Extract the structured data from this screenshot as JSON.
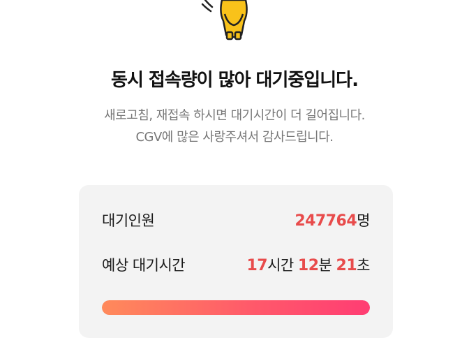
{
  "title": "동시 접속량이 많아 대기중입니다.",
  "subtitle_line1": "새로고침, 재접속 하시면 대기시간이 더 길어집니다.",
  "subtitle_line2": "CGV에 많은 사랑주셔서 감사드립니다.",
  "queue": {
    "waiting_label": "대기인원",
    "waiting_count": "247764",
    "waiting_unit": "명",
    "estimated_label": "예상 대기시간",
    "hours": "17",
    "hours_unit": "시간",
    "minutes": "12",
    "minutes_unit": "분",
    "seconds": "21",
    "seconds_unit": "초",
    "progress_percent": 100
  },
  "mascot_icon": "bowing-mascot-icon",
  "colors": {
    "accent": "#e84b4b",
    "progress_start": "#ff8a5b",
    "progress_end": "#ff3d73",
    "card_bg": "#f3f3f3"
  }
}
